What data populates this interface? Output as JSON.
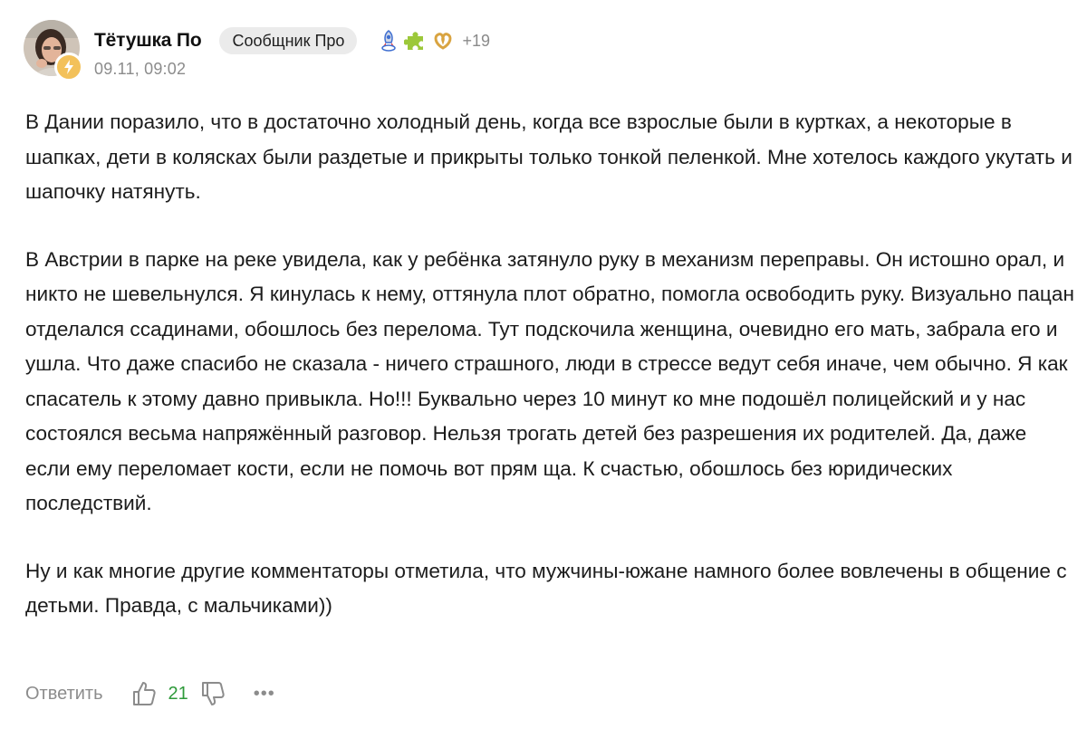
{
  "author": {
    "name": "Тётушка По",
    "role_badge": "Сообщник Про",
    "extra_badges_count": "+19",
    "timestamp": "09.11, 09:02",
    "badges": [
      "rocket-icon",
      "puzzle-icon",
      "pretzel-icon"
    ],
    "avatar_badge_icon": "lightning-icon"
  },
  "comment": {
    "paragraphs": [
      "В Дании поразило, что в достаточно холодный день, когда все взрослые были в куртках, а некоторые в шапках, дети в колясках были раздетые и прикрыты только тонкой пеленкой. Мне хотелось каждого укутать и шапочку натянуть.",
      "В Австрии в парке на реке увидела, как у ребёнка затянуло руку в механизм переправы. Он истошно орал, и никто не шевельнулся. Я кинулась к нему, оттянула плот обратно, помогла освободить руку. Визуально пацан отделался ссадинами, обошлось без перелома. Тут подскочила женщина, очевидно его мать, забрала его и ушла. Что даже спасибо не сказала - ничего страшного, люди в стрессе ведут себя иначе, чем обычно. Я как спасатель к этому давно привыкла. Но!!! Буквально через 10 минут ко мне подошёл полицейский и у нас состоялся весьма напряжённый разговор. Нельзя трогать детей без разрешения их родителей. Да, даже если ему переломает кости, если не помочь вот прям ща. К счастью, обошлось без юридических последствий.",
      "Ну и как многие другие комментаторы отметила, что мужчины-южане намного более вовлечены в общение с детьми. Правда, с мальчиками))"
    ]
  },
  "actions": {
    "reply_label": "Ответить",
    "like_count": "21",
    "more_label": "•••"
  },
  "colors": {
    "like_count": "#2e9a3a",
    "muted_text": "#8c8c8c",
    "badge_bg": "#ebebeb",
    "avatar_badge": "#f3c15a"
  }
}
